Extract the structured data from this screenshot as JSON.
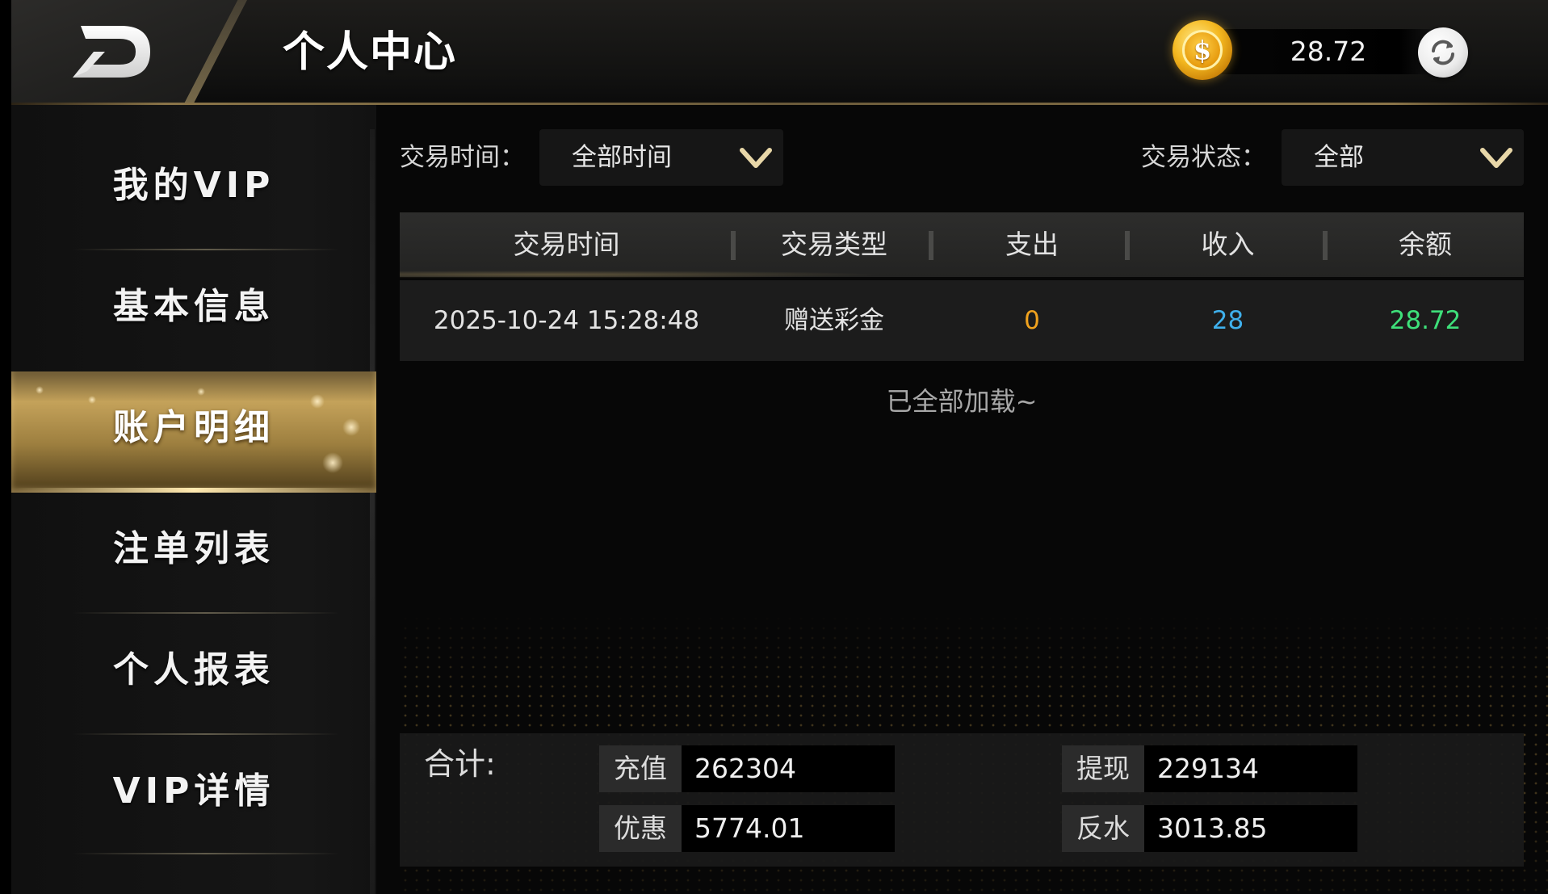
{
  "header": {
    "title": "个人中心",
    "balance": "28.72"
  },
  "sidebar": {
    "items": [
      {
        "label": "我的VIP",
        "active": false
      },
      {
        "label": "基本信息",
        "active": false
      },
      {
        "label": "账户明细",
        "active": true
      },
      {
        "label": "注单列表",
        "active": false
      },
      {
        "label": "个人报表",
        "active": false
      },
      {
        "label": "VIP详情",
        "active": false
      }
    ]
  },
  "filters": {
    "time_label": "交易时间：",
    "time_value": "全部时间",
    "status_label": "交易状态：",
    "status_value": "全部"
  },
  "table": {
    "columns": [
      "交易时间",
      "交易类型",
      "支出",
      "收入",
      "余额"
    ],
    "rows": [
      {
        "time": "2025-10-24 15:28:48",
        "type": "赠送彩金",
        "expense": "0",
        "income": "28",
        "balance": "28.72"
      }
    ],
    "end_text": "已全部加载~"
  },
  "summary": {
    "title": "合计:",
    "recharge_label": "充值",
    "recharge_value": "262304",
    "withdraw_label": "提现",
    "withdraw_value": "229134",
    "promo_label": "优惠",
    "promo_value": "5774.01",
    "rebate_label": "反水",
    "rebate_value": "3013.85"
  },
  "colors": {
    "accent_gold": "#c4a25a",
    "expense": "#f0a21e",
    "income": "#3fb0ec",
    "balance": "#3ee07a"
  },
  "icons": {
    "back": "back-arrow-icon",
    "coin": "gold-coin-icon",
    "refresh": "refresh-icon",
    "dropdown": "chevron-down-icon"
  }
}
